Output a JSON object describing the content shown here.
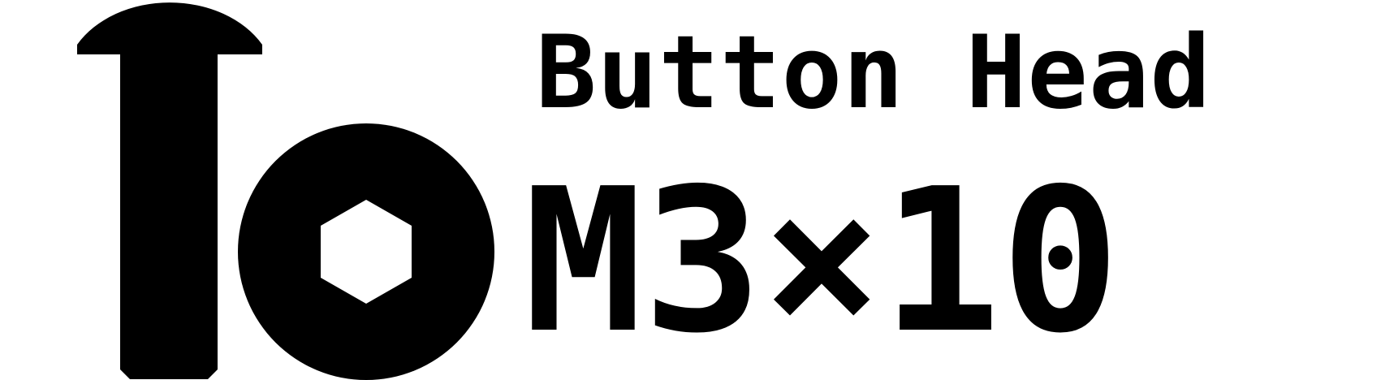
{
  "label": {
    "head_type": "Button Head",
    "size": "M3×10",
    "drive_icon": "hex-socket-icon",
    "profile_icon": "screw-side-profile-icon"
  },
  "colors": {
    "foreground": "#000000",
    "background": "#ffffff"
  }
}
